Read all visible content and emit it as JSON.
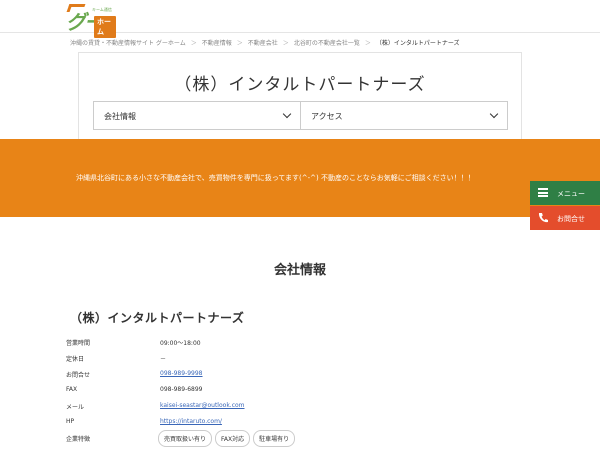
{
  "logo": {
    "mark": "グー",
    "tagline": "キーム通信",
    "box": "ホーム"
  },
  "breadcrumb": [
    "沖縄の賃貸・不動産情報サイト グーホーム",
    "不動産情報",
    "不動産会社",
    "北谷町の不動産会社一覧",
    "（株）インタルトパートナーズ"
  ],
  "card": {
    "title": "（株）インタルトパートナーズ",
    "select1": "会社情報",
    "select2": "アクセス"
  },
  "banner": {
    "text": "沖縄県北谷町にある小さな不動産会社で、売買物件を専門に扱ってます(^-^) 不動産のことならお気軽にご相談ください！！！"
  },
  "side": {
    "menu": "メニュー",
    "contact": "お問合せ"
  },
  "section_title": "会社情報",
  "company_name": "（株）インタルトパートナーズ",
  "info": {
    "hours_label": "営業時間",
    "hours": "09:00～18:00",
    "holiday_label": "定休日",
    "holiday": "－",
    "contact_label": "お問合せ",
    "contact": "098-989-9998",
    "fax_label": "FAX",
    "fax": "098-989-6899",
    "mail_label": "メール",
    "mail": "kaisei-seastar@outlook.com",
    "hp_label": "HP",
    "hp": "https://intaruto.com/",
    "features_label": "企業特徴",
    "features": [
      "売買取扱い有り",
      "FAX対応",
      "駐車場有り"
    ]
  },
  "colors": {
    "accent": "#e88417",
    "menu": "#2f7f45",
    "contact": "#e44d2c",
    "link": "#3a67b8"
  }
}
